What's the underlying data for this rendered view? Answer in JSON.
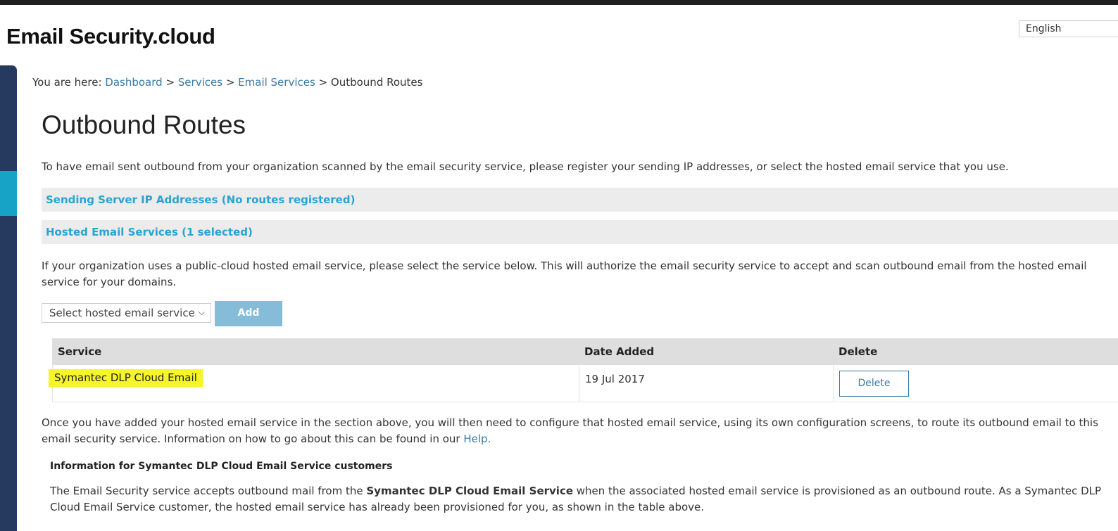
{
  "brand": "Email Security.cloud",
  "language": "English",
  "breadcrumb": {
    "prefix": "You are here: ",
    "items": [
      "Dashboard",
      "Services",
      "Email Services",
      "Outbound Routes"
    ],
    "separator": " > "
  },
  "page_title": "Outbound Routes",
  "intro": "To have email sent outbound from your organization scanned by the email security service, please register your sending IP addresses, or select the hosted email service that you use.",
  "sections": {
    "sending_ip": "Sending Server IP Addresses (No routes registered)",
    "hosted": "Hosted Email Services (1 selected)"
  },
  "hosted_desc": "If your organization uses a public-cloud hosted email service, please select the service below. This will authorize the email security service to accept and scan outbound email from the hosted email service for your domains.",
  "select": {
    "value": "Select hosted email service"
  },
  "add_label": "Add",
  "table": {
    "headers": [
      "Service",
      "Date Added",
      "Delete"
    ],
    "rows": [
      {
        "service": "Symantec DLP Cloud Email",
        "date": "19 Jul 2017",
        "action": "Delete"
      }
    ]
  },
  "after_text": "Once you have added your hosted email service in the section above, you will then need to configure that hosted email service, using its own configuration screens, to route its outbound email to this email security service. Information on how to go about this can be found in our ",
  "help_link": "Help.",
  "info_heading": "Information for Symantec DLP Cloud Email Service customers",
  "info": {
    "part1": "The Email Security service accepts outbound mail from the ",
    "bold": "Symantec DLP Cloud Email Service",
    "part2": " when the associated hosted email service is provisioned as an outbound route. As a Symantec DLP Cloud Email Service customer, the hosted email service has already been provisioned for you, as shown in the table above."
  },
  "colors": {
    "link": "#3879a6",
    "section_title": "#2aa3d3",
    "sidebar": "#253a5e",
    "sidebar_active": "#16a3c5",
    "highlight": "#f5f52a",
    "add_button": "#86bcd7"
  },
  "icons": {
    "select_chevron": "chevron-down-icon"
  }
}
